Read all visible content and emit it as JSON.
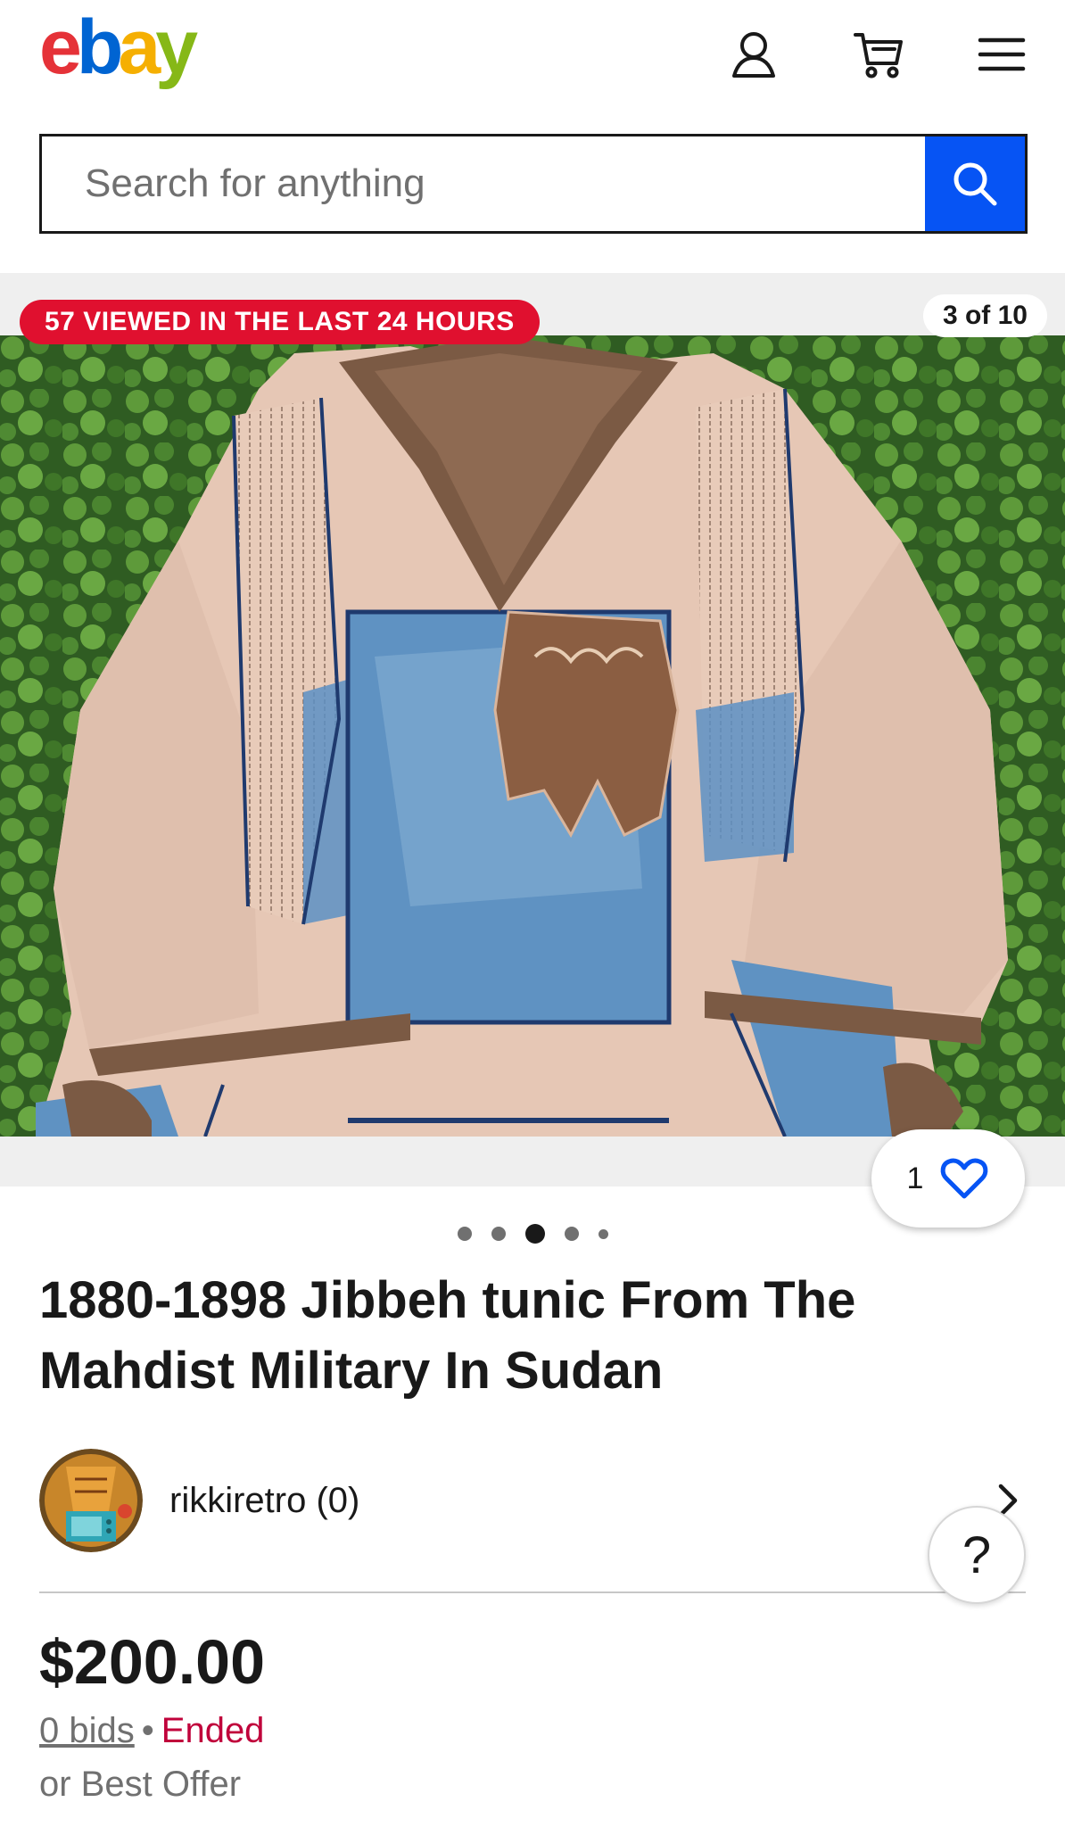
{
  "header": {
    "logo": {
      "e": "e",
      "b": "b",
      "a": "a",
      "y": "y"
    },
    "icons": [
      "user-icon",
      "cart-icon",
      "menu-icon"
    ]
  },
  "search": {
    "placeholder": "Search for anything",
    "button_icon": "search-icon"
  },
  "gallery": {
    "views_badge": "57 VIEWED IN THE LAST 24 HOURS",
    "counter": "3 of 10",
    "watch_count": "1",
    "dot_count": 5,
    "active_dot": 3
  },
  "listing": {
    "title": "1880-1898 Jibbeh tunic From The Mahdist Military In Sudan",
    "seller": "rikkiretro (0)",
    "price": "$200.00",
    "bids": "0 bids",
    "separator": "•",
    "status": "Ended",
    "offer": "or Best Offer"
  },
  "help": {
    "label": "?"
  },
  "colors": {
    "accent_blue": "#0654f4",
    "badge_red": "#e0102f",
    "ended_red": "#c0023b"
  }
}
